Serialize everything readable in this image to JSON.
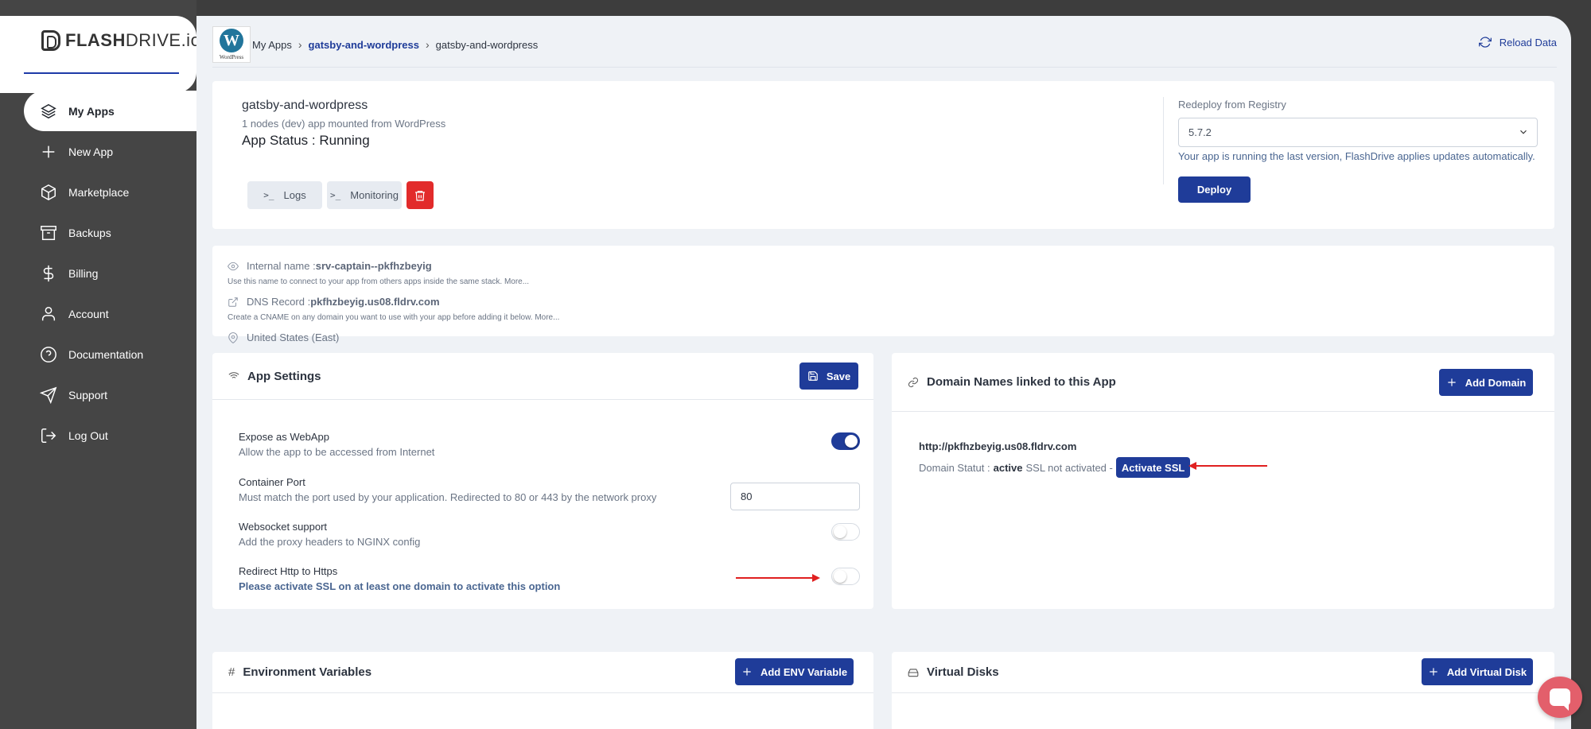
{
  "sidebar": {
    "logo_bold": "FLASH",
    "logo_rest": "DRIVE.io",
    "items": [
      {
        "label": "My Apps",
        "icon": "layers-icon"
      },
      {
        "label": "New App",
        "icon": "plus-icon"
      },
      {
        "label": "Marketplace",
        "icon": "cube-icon"
      },
      {
        "label": "Backups",
        "icon": "archive-icon"
      },
      {
        "label": "Billing",
        "icon": "dollar-icon"
      },
      {
        "label": "Account",
        "icon": "user-icon"
      },
      {
        "label": "Documentation",
        "icon": "help-circle-icon"
      },
      {
        "label": "Support",
        "icon": "send-icon"
      },
      {
        "label": "Log Out",
        "icon": "logout-icon"
      }
    ]
  },
  "topbar": {
    "wp_letter": "W",
    "wp_word": "WordPress",
    "crumb_root": "My Apps",
    "crumb_link": "gatsby-and-wordpress",
    "crumb_current": "gatsby-and-wordpress",
    "reload_label": "Reload Data"
  },
  "app": {
    "name": "gatsby-and-wordpress",
    "subtitle": "1 nodes (dev) app mounted from WordPress",
    "status": "App Status : Running",
    "logs_label": "Logs",
    "monitoring_label": "Monitoring",
    "prompt_glyph": ">_",
    "redeploy_label": "Redeploy from Registry",
    "version_selected": "5.7.2",
    "redeploy_note": "Your app is running the last version, FlashDrive applies updates automatically.",
    "deploy_label": "Deploy"
  },
  "info": {
    "internal_label": "Internal name :",
    "internal_value": "srv-captain--pkfhzbeyig",
    "internal_note": "Use this name to connect to your app from others apps inside the same stack. More...",
    "dns_label": "DNS Record :",
    "dns_value": "pkfhzbeyig.us08.fldrv.com",
    "dns_note": "Create a CNAME on any domain you want to use with your app before adding it below. More...",
    "region": "United States (East)"
  },
  "settings": {
    "title": "App Settings",
    "save_label": "Save",
    "rows": [
      {
        "title": "Expose as WebApp",
        "desc": "Allow the app to be accessed from Internet",
        "enabled": true
      },
      {
        "title": "Container Port",
        "desc": "Must match the port used by your application. Redirected to 80 or 443 by the network proxy",
        "value": "80"
      },
      {
        "title": "Websocket support",
        "desc": "Add the proxy headers to NGINX config",
        "enabled": false
      },
      {
        "title": "Redirect Http to Https",
        "desc": "Please activate SSL on at least one domain to activate this option",
        "enabled": false
      }
    ]
  },
  "domains": {
    "title": "Domain Names linked to this App",
    "add_label": "Add Domain",
    "url": "http://pkfhzbeyig.us08.fldrv.com",
    "status_prefix": "Domain Statut :",
    "status_value": "active",
    "ssl_text": "SSL not activated -",
    "activate_label": "Activate SSL"
  },
  "env": {
    "title": "Environment Variables",
    "add_label": "Add ENV Variable"
  },
  "disks": {
    "title": "Virtual Disks",
    "add_label": "Add Virtual Disk"
  },
  "colors": {
    "accent": "#1f3c99",
    "danger": "#e22b2b",
    "sidebar": "#454545",
    "chat": "#e35f6b",
    "annotation_arrow": "#e02020"
  }
}
